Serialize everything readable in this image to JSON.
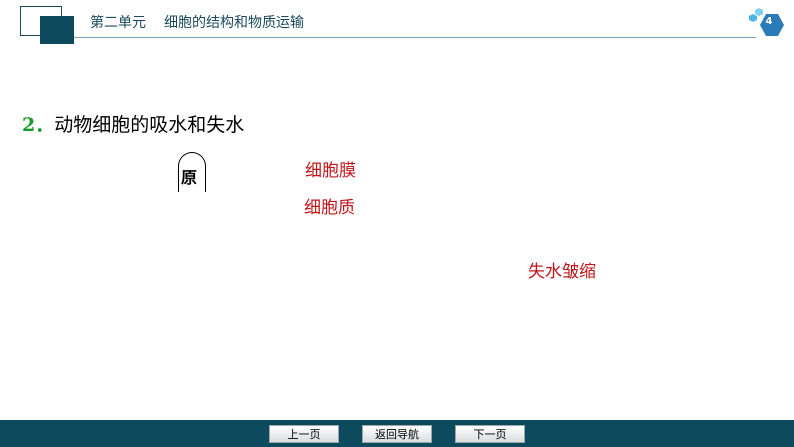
{
  "header": {
    "unit": "第二单元",
    "topic": "细胞的结构和物质运输",
    "page_number": "4"
  },
  "content": {
    "section_number": "2",
    "section_title": "动物细胞的吸水和失水",
    "arch_label": "原",
    "labels": {
      "membrane": "细胞膜",
      "cytoplasm": "细胞质",
      "shrink": "失水皱缩"
    }
  },
  "footer": {
    "prev_label": "上一页",
    "back_label": "返回导航",
    "next_label": "下一页"
  },
  "colors": {
    "header_dark": "#0d4a5e",
    "section_number": "#1e9a2a",
    "highlight_red": "#c0161b",
    "badge_blue": "#2b7bb9"
  }
}
